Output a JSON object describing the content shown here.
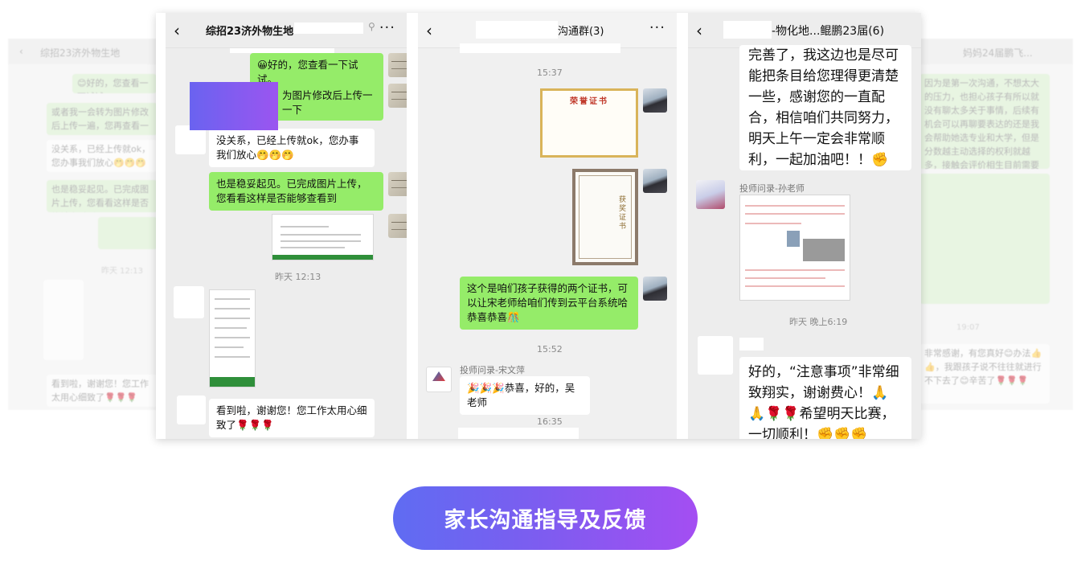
{
  "background": {
    "left": {
      "title": "综招23济外物生地",
      "bubbles": [
        "😊好的，您查看一下试试。",
        "或者我一会转为图片修改后上传一遍，您再查看一下",
        "没关系，已经上传就ok，您办事我们放心🤭🤭🤭",
        "也是稳妥起见。已完成图片上传，您看看这样是否能够查看到",
        "看到啦，谢谢您！您工作太用心细致了🌹🌹🌹"
      ],
      "time": "昨天 12:13"
    },
    "right": {
      "title": "妈妈24届鹏飞...",
      "bubbles": [
        "因为是第一次沟通，不想太大的压力，也担心孩子有所以就没有聊太多关于事情，后续有机会可以再聊要表达的还是我会帮助她选专业和大学，但是分数越主动选择的权利就越多，接触会评价相生目前需要参",
        "非常感谢，有您真好😊办法👍👍，我跟孩子说不往往就进行不下去了😊辛苦了🌹🌹🌹"
      ],
      "time": "19:07"
    }
  },
  "panel1": {
    "title": "综招23济外物生地",
    "time": "昨天 12:13",
    "messages": {
      "m1": "😀好的，您查看一下试试。",
      "m2a": "为图片修改后上传一",
      "m2b": "一下",
      "m3": "没关系，已经上传就ok，您办事我们放心🤭🤭🤭",
      "m4": "也是稳妥起见。已完成图片上传，您看看这样是否能够查看到",
      "m5": "看到啦，谢谢您！您工作太用心细致了🌹🌹🌹"
    }
  },
  "panel2": {
    "title": "沟通群(3)",
    "times": [
      "15:37",
      "15:52",
      "16:35"
    ],
    "cert_title": "荣誉证书",
    "cert_v_title": "获奖证书",
    "message": "这个是咱们孩子获得的两个证书，可以让宋老师给咱们传到云平台系统哈 恭喜恭喜🎊",
    "sender": "投师问录-宋文萍",
    "reply": "🎉🎉🎉恭喜，好的，吴老师"
  },
  "panel3": {
    "title": "-物化地...鲲鹏23届(6)",
    "top_message": "完善了，我这边也是尽可能把条目给您理得更清楚一些，感谢您的一直配合，相信咱们共同努力，明天上午一定会非常顺利，一起加油吧！！✊✊✊",
    "sender": "投师问录-孙老师",
    "time": "昨天 晚上6:19",
    "bottom_message": "好的，“注意事项”非常细致翔实，谢谢费心！🙏🙏🌹🌹希望明天比赛，一切顺利！✊✊✊"
  },
  "cta": {
    "label": "家长沟通指导及反馈"
  }
}
